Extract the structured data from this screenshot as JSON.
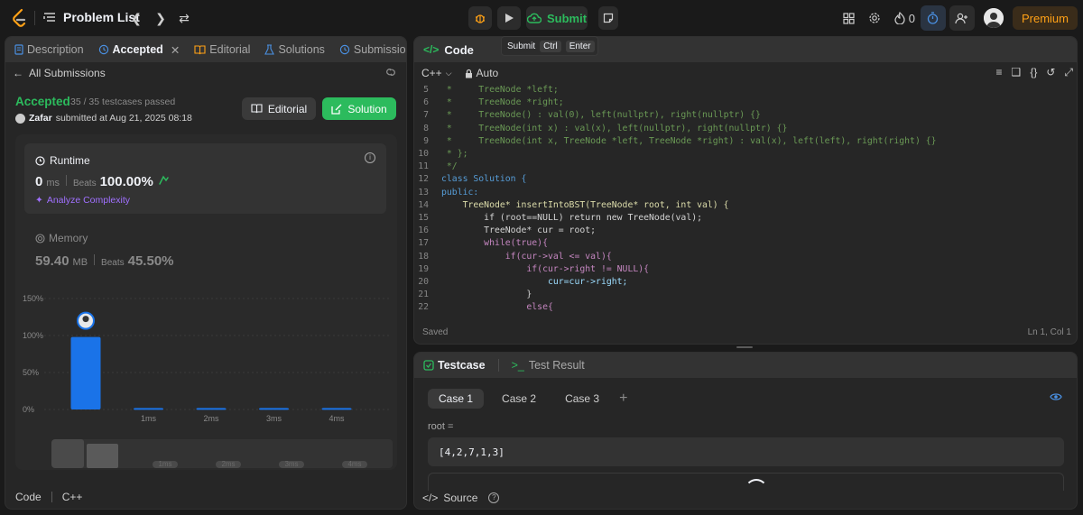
{
  "topbar": {
    "problem_list": "Problem List",
    "submit_label": "Submit",
    "fire_count": "0",
    "premium_label": "Premium"
  },
  "tooltip": {
    "label": "Submit",
    "key1": "Ctrl",
    "key2": "Enter"
  },
  "left_tabs": [
    {
      "label": "Description"
    },
    {
      "label": "Accepted"
    },
    {
      "label": "Editorial"
    },
    {
      "label": "Solutions"
    },
    {
      "label": "Submissions"
    }
  ],
  "submission": {
    "back_label": "All Submissions",
    "status": "Accepted",
    "testcases": "35 / 35 testcases passed",
    "username": "Zafar",
    "submitted_at": "submitted at Aug 21, 2025 08:18",
    "editorial_label": "Editorial",
    "solution_label": "Solution"
  },
  "runtime": {
    "title": "Runtime",
    "value": "0",
    "unit": "ms",
    "beats_label": "Beats",
    "beats_value": "100.00%",
    "analyze": "Analyze Complexity"
  },
  "memory": {
    "title": "Memory",
    "value": "59.40",
    "unit": "MB",
    "beats_label": "Beats",
    "beats_value": "45.50%"
  },
  "chart_data": {
    "type": "bar",
    "categories": [
      "",
      "1ms",
      "2ms",
      "3ms",
      "4ms"
    ],
    "values": [
      98,
      2,
      2,
      2,
      2
    ],
    "ylim": [
      0,
      150
    ],
    "y_ticks": [
      "0%",
      "50%",
      "100%",
      "150%"
    ],
    "y_tick_values": [
      0,
      50,
      100,
      150
    ],
    "highlight_index": 0,
    "bar_color": "#1a73e8",
    "mini_labels": [
      "1ms",
      "2ms",
      "3ms",
      "4ms"
    ]
  },
  "left_bottom": {
    "code_label": "Code",
    "lang": "C++"
  },
  "code": {
    "title": "Code",
    "lang": "C++",
    "mode": "Auto",
    "saved": "Saved",
    "position": "Ln 1, Col 1",
    "lines": [
      {
        "n": "5",
        "t": " *     TreeNode *left;"
      },
      {
        "n": "6",
        "t": " *     TreeNode *right;"
      },
      {
        "n": "7",
        "t": " *     TreeNode() : val(0), left(nullptr), right(nullptr) {}"
      },
      {
        "n": "8",
        "t": " *     TreeNode(int x) : val(x), left(nullptr), right(nullptr) {}"
      },
      {
        "n": "9",
        "t": " *     TreeNode(int x, TreeNode *left, TreeNode *right) : val(x), left(left), right(right) {}"
      },
      {
        "n": "10",
        "t": " * };"
      },
      {
        "n": "11",
        "t": " */"
      },
      {
        "n": "12",
        "t": "class Solution {"
      },
      {
        "n": "13",
        "t": "public:"
      },
      {
        "n": "14",
        "t": "    TreeNode* insertIntoBST(TreeNode* root, int val) {"
      },
      {
        "n": "15",
        "t": "        if (root==NULL) return new TreeNode(val);"
      },
      {
        "n": "16",
        "t": "        TreeNode* cur = root;"
      },
      {
        "n": "17",
        "t": "        while(true){"
      },
      {
        "n": "18",
        "t": "            if(cur->val <= val){"
      },
      {
        "n": "19",
        "t": "                if(cur->right != NULL){"
      },
      {
        "n": "20",
        "t": "                    cur=cur->right;"
      },
      {
        "n": "21",
        "t": "                }"
      },
      {
        "n": "22",
        "t": "                else{"
      }
    ]
  },
  "test": {
    "testcase_tab": "Testcase",
    "result_tab": "Test Result",
    "cases": [
      "Case 1",
      "Case 2",
      "Case 3"
    ],
    "plus": "+",
    "root_label": "root =",
    "root_value": "[4,2,7,1,3]",
    "source_label": "Source"
  }
}
